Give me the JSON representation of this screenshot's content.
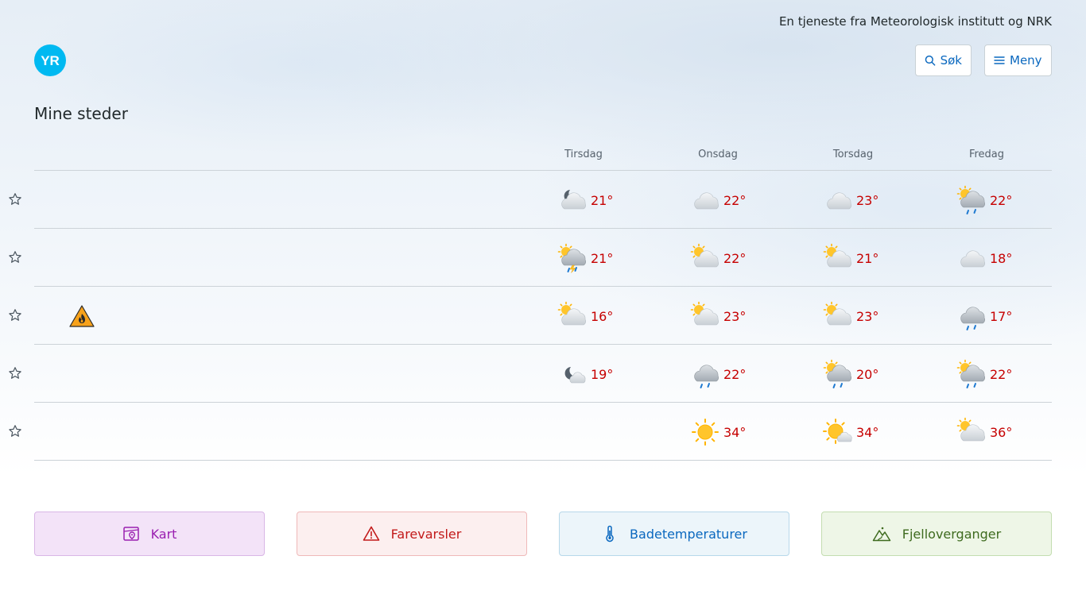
{
  "header": {
    "tagline": "En tjeneste fra Meteorologisk institutt og NRK",
    "logo_text": "YR",
    "search_label": "Søk",
    "menu_label": "Meny"
  },
  "page": {
    "title": "Mine steder"
  },
  "days": [
    "Tirsdag",
    "Onsdag",
    "Torsdag",
    "Fredag"
  ],
  "locations": [
    {
      "name": "",
      "warning": null,
      "forecast": [
        {
          "icon": "partly-cloudy-night-icon",
          "temp": "21°"
        },
        {
          "icon": "cloudy-icon",
          "temp": "22°"
        },
        {
          "icon": "cloudy-icon",
          "temp": "23°"
        },
        {
          "icon": "partly-cloudy-rain-icon",
          "temp": "22°"
        }
      ]
    },
    {
      "name": "",
      "warning": null,
      "forecast": [
        {
          "icon": "rain-thunder-icon",
          "temp": "21°"
        },
        {
          "icon": "partly-cloudy-day-icon",
          "temp": "22°"
        },
        {
          "icon": "partly-cloudy-day-icon",
          "temp": "21°"
        },
        {
          "icon": "cloudy-icon",
          "temp": "18°"
        }
      ]
    },
    {
      "name": "",
      "warning": "forest-fire-warning-icon",
      "forecast": [
        {
          "icon": "partly-cloudy-day-icon",
          "temp": "16°"
        },
        {
          "icon": "partly-cloudy-day-icon",
          "temp": "23°"
        },
        {
          "icon": "partly-cloudy-day-icon",
          "temp": "23°"
        },
        {
          "icon": "rain-icon",
          "temp": "17°"
        }
      ]
    },
    {
      "name": "",
      "warning": null,
      "forecast": [
        {
          "icon": "fair-night-icon",
          "temp": "19°"
        },
        {
          "icon": "rain-icon",
          "temp": "22°"
        },
        {
          "icon": "partly-cloudy-rain-icon",
          "temp": "20°"
        },
        {
          "icon": "partly-cloudy-rain-icon",
          "temp": "22°"
        }
      ]
    },
    {
      "name": "",
      "warning": null,
      "forecast": [
        {
          "icon": "",
          "temp": ""
        },
        {
          "icon": "clear-sky-icon",
          "temp": "34°"
        },
        {
          "icon": "fair-day-icon",
          "temp": "34°"
        },
        {
          "icon": "partly-cloudy-day-icon",
          "temp": "36°"
        }
      ]
    }
  ],
  "quick_links": [
    {
      "label": "Kart",
      "icon": "map-icon"
    },
    {
      "label": "Farevarsler",
      "icon": "warning-triangle-icon"
    },
    {
      "label": "Badetemperaturer",
      "icon": "thermometer-icon"
    },
    {
      "label": "Fjelloverganger",
      "icon": "mountain-pass-icon"
    }
  ],
  "colors": {
    "temp_warm": "#c60000",
    "link_blue": "#0a68bf",
    "logo_blue": "#00b9f1"
  }
}
